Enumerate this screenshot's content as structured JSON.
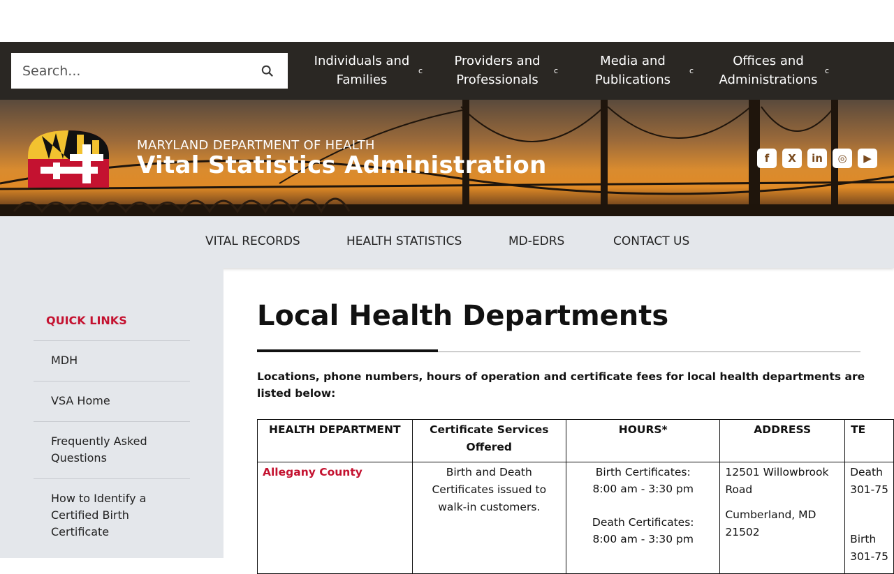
{
  "search": {
    "placeholder": "Search..."
  },
  "topnav": [
    {
      "line1": "Individuals and",
      "line2": "Families",
      "caret": "c"
    },
    {
      "line1": "Providers and",
      "line2": "Professionals",
      "caret": "c"
    },
    {
      "line1": "Media and",
      "line2": "Publications",
      "caret": "c"
    },
    {
      "line1": "Offices and",
      "line2": "Administrations",
      "caret": "c"
    }
  ],
  "header": {
    "department": "MARYLAND DEPARTMENT OF HEALTH",
    "title": "Vital Statistics Administration"
  },
  "social": [
    "facebook-icon",
    "x-icon",
    "linkedin-icon",
    "instagram-icon",
    "youtube-icon"
  ],
  "subnav": [
    "VITAL RECORDS",
    "HEALTH STATISTICS",
    "MD-EDRS",
    "CONTACT US"
  ],
  "sidebar": {
    "title": "QUICK LINKS",
    "items": [
      "MDH",
      "VSA Home",
      "Frequently Asked Questions",
      "How to Identify a Certified Birth Certificate"
    ]
  },
  "main": {
    "heading": "Local Health Departments",
    "intro": "Locations, phone numbers, hours of operation and certificate fees for local health departments are listed below:",
    "table": {
      "headers": [
        "HEALTH DEPARTMENT",
        "Certificate Services Offered",
        "HOURS*",
        "ADDRESS",
        "TE"
      ],
      "row": {
        "department": "Allegany County",
        "services": "Birth and Death Certificates issued to walk-in customers.",
        "hours_birth_label": "Birth Certificates:",
        "hours_birth": "8:00 am - 3:30 pm",
        "hours_death_label": "Death Certificates:",
        "hours_death": "8:00 am - 3:30 pm",
        "address_street": "12501 Willowbrook Road",
        "address_city": "Cumberland, MD 21502",
        "phone_death": "Death",
        "phone_death_num": "301-75",
        "phone_birth": "Birth",
        "phone_birth_num": "301-75"
      }
    }
  },
  "colors": {
    "accent": "#c41230",
    "topbar": "#2a2723",
    "subnav": "#e4e7eb"
  }
}
